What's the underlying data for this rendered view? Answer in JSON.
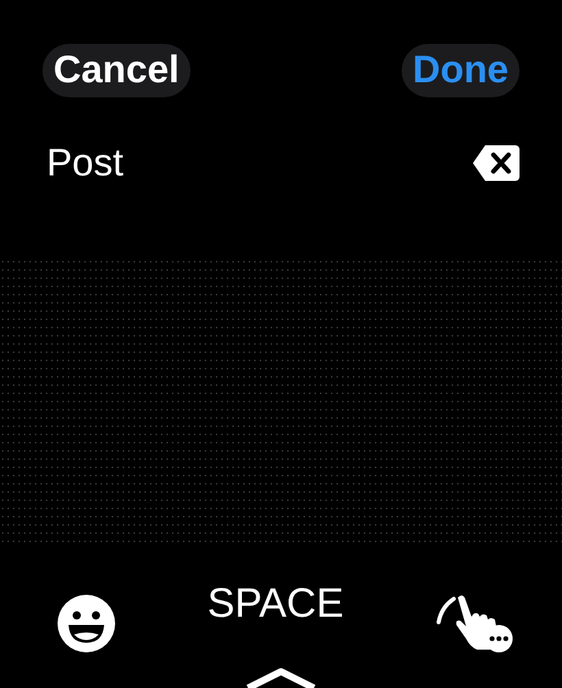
{
  "header": {
    "cancel": "Cancel",
    "done": "Done"
  },
  "input": {
    "value": "Post"
  },
  "bottom_bar": {
    "space": "SPACE"
  }
}
